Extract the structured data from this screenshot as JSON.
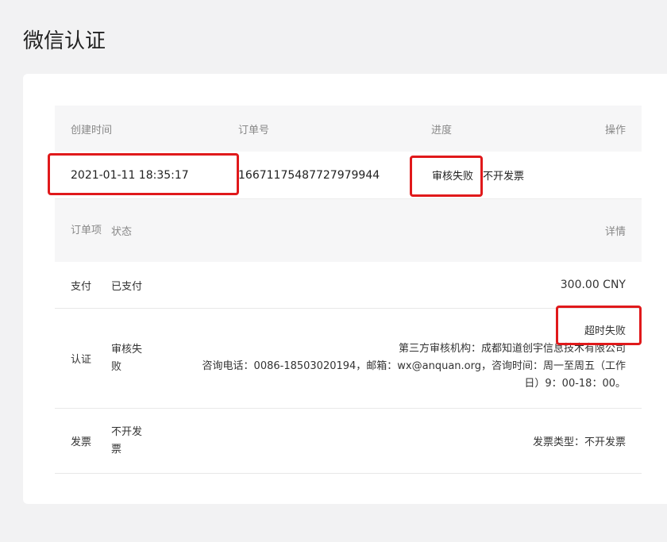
{
  "page_title": "微信认证",
  "order_table": {
    "headers": {
      "created": "创建时间",
      "order_no": "订单号",
      "progress": "进度",
      "action": "操作"
    },
    "row": {
      "created": "2021-01-11 18:35:17",
      "order_no": "16671175487727979944",
      "progress": "审核失败",
      "invoice": "不开发票"
    }
  },
  "items_table": {
    "headers": {
      "item": "订单项",
      "status": "状态",
      "detail": "详情"
    },
    "rows": [
      {
        "item": "支付",
        "status": "已支付",
        "detail": "300.00 CNY"
      },
      {
        "item": "认证",
        "status": "审核失败",
        "detail_title": "超时失败",
        "detail_org": "第三方审核机构：成都知道创宇信息技术有限公司",
        "detail_contact_1": "咨询电话：0086-18503020194，邮箱：wx@anquan.org，咨询时间：周一至周五（工作",
        "detail_contact_2": "日）9：00-18：00。"
      },
      {
        "item": "发票",
        "status": "不开发票",
        "detail": "发票类型：不开发票"
      }
    ]
  },
  "colors": {
    "highlight_box": "#e0191b",
    "header_bg": "#f6f6f7",
    "page_bg": "#f2f2f3"
  }
}
